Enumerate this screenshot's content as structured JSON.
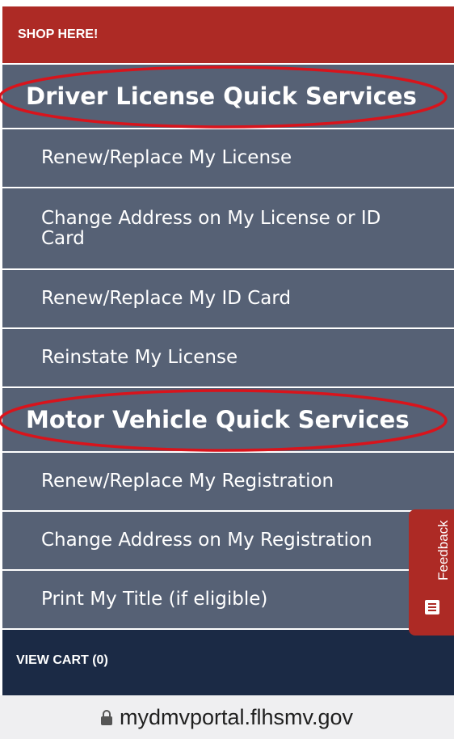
{
  "shop": {
    "label": "SHOP HERE!"
  },
  "driver_license": {
    "heading": "Driver License Quick Services",
    "items": [
      {
        "label": "Renew/Replace My License"
      },
      {
        "label": "Change Address on My License or ID Card"
      },
      {
        "label": "Renew/Replace My ID Card"
      },
      {
        "label": "Reinstate My License"
      }
    ]
  },
  "motor_vehicle": {
    "heading": "Motor Vehicle Quick Services",
    "items": [
      {
        "label": "Renew/Replace My Registration"
      },
      {
        "label": "Change Address on My Registration"
      },
      {
        "label": "Print My Title (if eligible)"
      }
    ]
  },
  "cart": {
    "label": "VIEW CART (0)"
  },
  "feedback": {
    "label": "Feedback",
    "icon": "list-icon"
  },
  "browser": {
    "url": "mydmvportal.flhsmv.gov",
    "icon": "lock-icon"
  },
  "colors": {
    "shop_red": "#ad2a25",
    "menu_slate": "#566175",
    "cart_navy": "#1b2a45",
    "annotation_red": "#d8141c",
    "url_bar": "#efeff1"
  }
}
